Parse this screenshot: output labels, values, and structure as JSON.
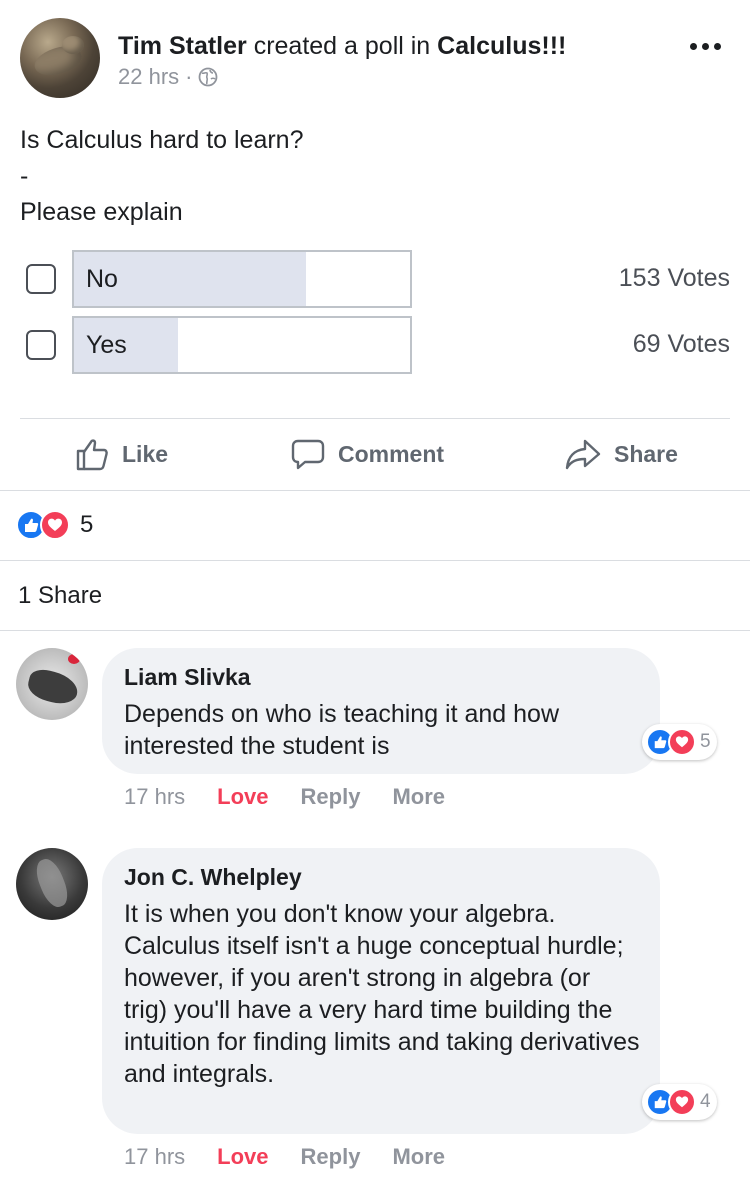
{
  "post": {
    "author": "Tim Statler",
    "action_text": "created a poll in",
    "group": "Calculus!!!",
    "time": "22 hrs",
    "separator": "·",
    "privacy_icon": "globe-icon",
    "lines": [
      "Is Calculus hard to learn?",
      "-",
      "Please explain"
    ]
  },
  "poll": {
    "options": [
      {
        "label": "No",
        "votes": "153 Votes",
        "count": 153,
        "fill_fraction": 0.69
      },
      {
        "label": "Yes",
        "votes": "69 Votes",
        "count": 69,
        "fill_fraction": 0.31
      }
    ]
  },
  "actions": {
    "like": "Like",
    "comment": "Comment",
    "share": "Share"
  },
  "reactions": {
    "count": "5",
    "types": [
      "like-icon",
      "love-icon"
    ]
  },
  "shares": "1 Share",
  "comments": [
    {
      "name": "Liam Slivka",
      "text": "Depends on who is teaching it and how interested the student is",
      "reaction_count": "5",
      "time": "17 hrs",
      "love": "Love",
      "reply": "Reply",
      "more": "More"
    },
    {
      "name": "Jon C. Whelpley",
      "text": "It is when you don't know your algebra. Calculus itself isn't a huge conceptual hurdle; however, if you aren't strong in algebra (or trig) you'll have a very hard time building the intuition for finding limits and taking derivatives and integrals.",
      "reaction_count": "4",
      "time": "17 hrs",
      "love": "Love",
      "reply": "Reply",
      "more": "More"
    }
  ],
  "colors": {
    "like_blue": "#1877f2",
    "love_red": "#f33e58",
    "poll_fill": "#dfe3ee",
    "bubble_bg": "#f0f2f5"
  }
}
